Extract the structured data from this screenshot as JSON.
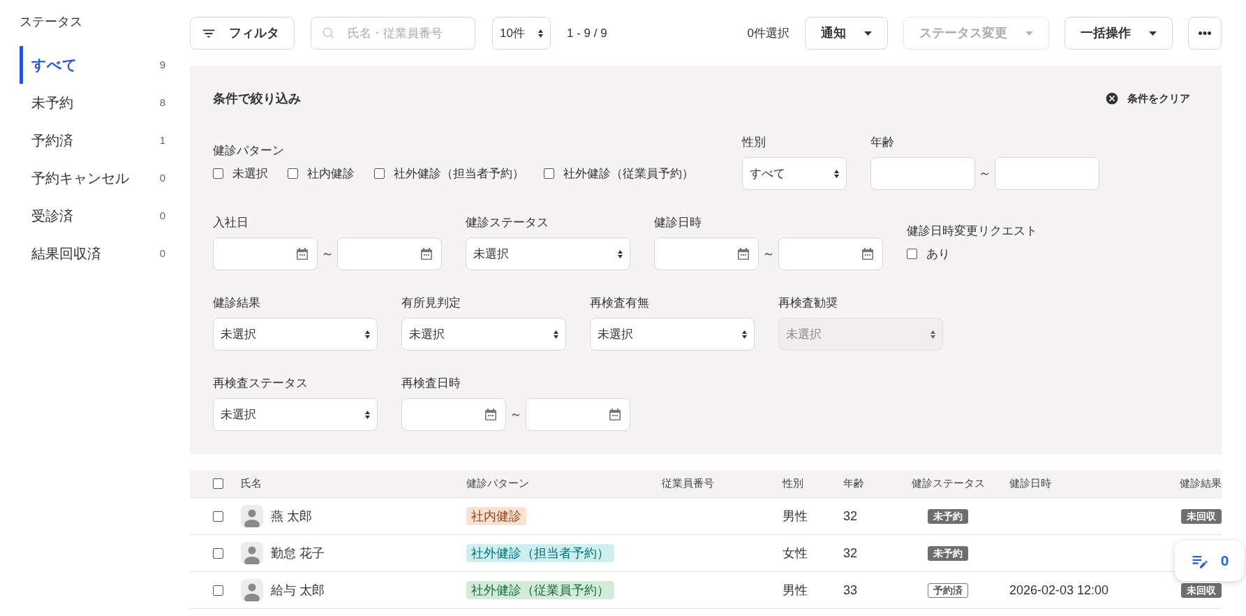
{
  "sidebar": {
    "title": "ステータス",
    "items": [
      {
        "label": "すべて",
        "count": "9",
        "selected": true
      },
      {
        "label": "未予約",
        "count": "8",
        "selected": false
      },
      {
        "label": "予約済",
        "count": "1",
        "selected": false
      },
      {
        "label": "予約キャンセル",
        "count": "0",
        "selected": false
      },
      {
        "label": "受診済",
        "count": "0",
        "selected": false
      },
      {
        "label": "結果回収済",
        "count": "0",
        "selected": false
      }
    ]
  },
  "toolbar": {
    "filter_button": "フィルタ",
    "search": {
      "placeholder": "氏名・従業員番号"
    },
    "page_size": "10件",
    "range": "1 - 9 / 9",
    "selection_count": "0件選択",
    "actions": [
      {
        "label": "通知",
        "disabled": false
      },
      {
        "label": "ステータス変更",
        "disabled": true
      },
      {
        "label": "一括操作",
        "disabled": false
      }
    ]
  },
  "filter_panel": {
    "title": "条件で絞り込み",
    "clear_button": "条件をクリア",
    "rows": [
      {
        "fields": [
          {
            "kind": "checkboxes",
            "label": "健診パターン",
            "options": [
              {
                "label": "未選択",
                "checked": false
              },
              {
                "label": "社内健診",
                "checked": false
              },
              {
                "label": "社外健診（担当者予約）",
                "checked": false
              },
              {
                "label": "社外健診（従業員予約）",
                "checked": false
              }
            ]
          },
          {
            "kind": "select",
            "label": "性別",
            "value": "すべて",
            "disabled": false
          },
          {
            "kind": "range",
            "label": "年齢",
            "separator": "～"
          }
        ]
      },
      {
        "fields": [
          {
            "kind": "date_range",
            "label": "入社日",
            "separator": "～"
          },
          {
            "kind": "select",
            "label": "健診ステータス",
            "value": "未選択",
            "disabled": false
          },
          {
            "kind": "date_range",
            "label": "健診日時",
            "separator": "～"
          },
          {
            "kind": "checkbox",
            "label": "健診日時変更リクエスト",
            "option": {
              "label": "あり",
              "checked": false
            }
          }
        ]
      },
      {
        "fields": [
          {
            "kind": "select",
            "label": "健診結果",
            "value": "未選択",
            "disabled": false
          },
          {
            "kind": "select",
            "label": "有所見判定",
            "value": "未選択",
            "disabled": false
          },
          {
            "kind": "select",
            "label": "再検査有無",
            "value": "未選択",
            "disabled": false
          },
          {
            "kind": "select",
            "label": "再検査勧奨",
            "value": "未選択",
            "disabled": true
          }
        ]
      },
      {
        "fields": [
          {
            "kind": "select",
            "label": "再検査ステータス",
            "value": "未選択",
            "disabled": false
          },
          {
            "kind": "date_range",
            "label": "再検査日時",
            "separator": "～"
          }
        ]
      }
    ]
  },
  "table": {
    "select_all": {
      "checked": false
    },
    "columns": [
      "氏名",
      "健診パターン",
      "従業員番号",
      "性別",
      "年齢",
      "健診ステータス",
      "健診日時",
      "健診結果"
    ],
    "rows": [
      {
        "checked": false,
        "name": "燕 太郎",
        "pattern": {
          "label": "社内健診",
          "color": "#fde0d2"
        },
        "gender": "男性",
        "age": "32",
        "status": {
          "label": "未予約",
          "kind": "solid"
        },
        "result": {
          "label": "未回収",
          "kind": "solid"
        }
      },
      {
        "checked": false,
        "name": "勤怠 花子",
        "pattern": {
          "label": "社外健診（担当者予約）",
          "color": "#cdeff0"
        },
        "gender": "女性",
        "age": "32",
        "status": {
          "label": "未予約",
          "kind": "solid"
        }
      },
      {
        "checked": false,
        "name": "給与 太郎",
        "pattern": {
          "label": "社外健診（従業員予約）",
          "color": "#d3ecd9"
        },
        "gender": "男性",
        "age": "33",
        "status": {
          "label": "予約済",
          "kind": "outline"
        },
        "datetime": "2026-02-03 12:00",
        "result": {
          "label": "未回収",
          "kind": "solid"
        }
      }
    ]
  },
  "floating_counter": {
    "count": "0"
  }
}
